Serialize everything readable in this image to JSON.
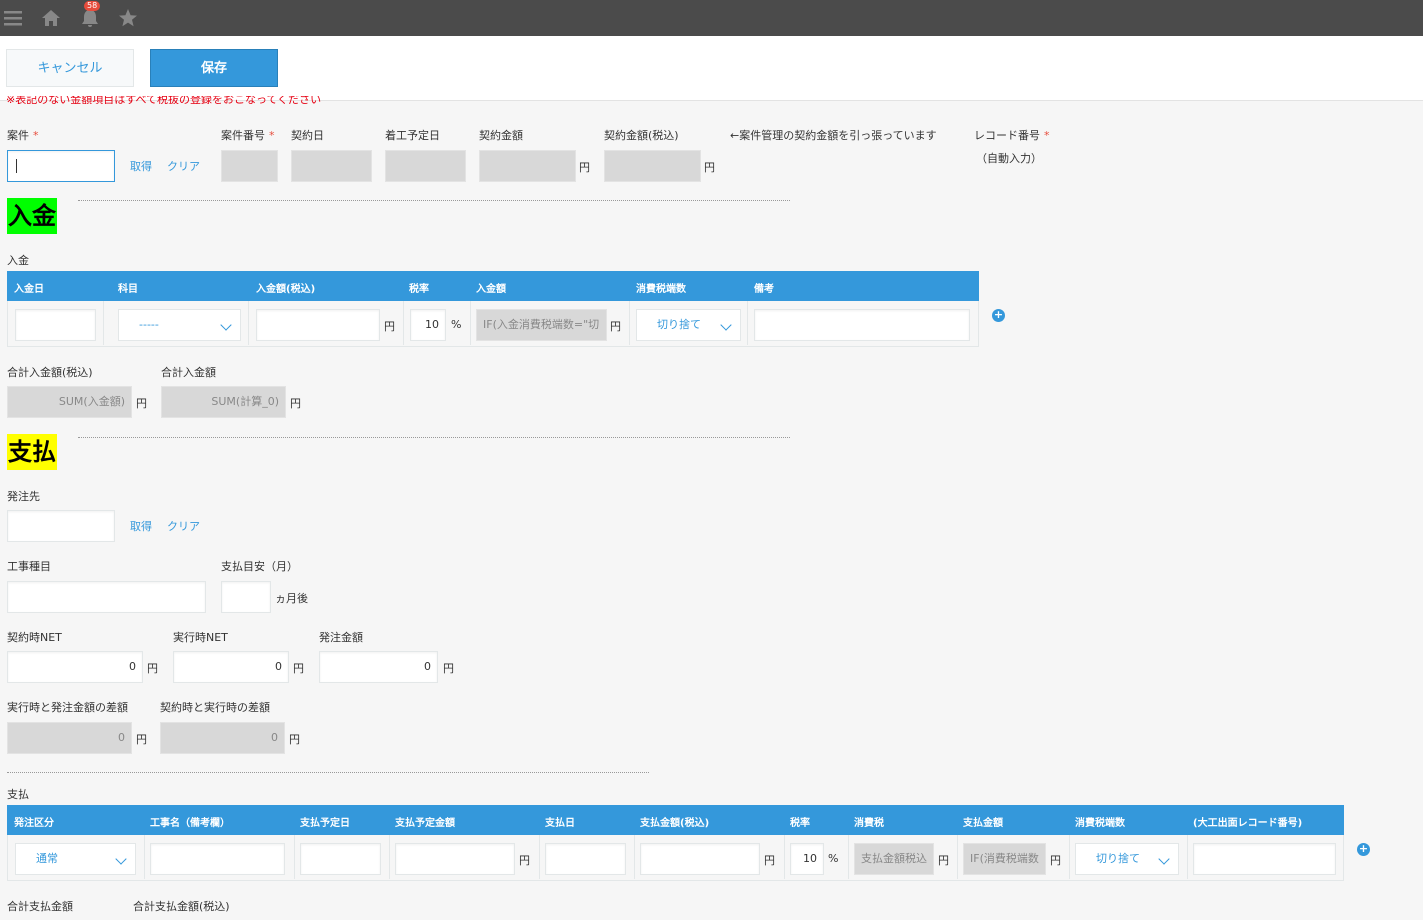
{
  "topbar": {
    "notification_count": "58"
  },
  "actions": {
    "cancel_label": "キャンセル",
    "save_label": "保存"
  },
  "notice": "※表記のない金額項目はすべて税抜の登録をおこなってください",
  "header": {
    "anken_label": "案件",
    "get_link": "取得",
    "clear_link": "クリア",
    "anken_no_label": "案件番号",
    "contract_date_label": "契約日",
    "start_date_label": "着工予定日",
    "contract_amount_label": "契約金額",
    "contract_amount_tax_label": "契約金額(税込)",
    "yen": "円",
    "note": "←案件管理の契約金額を引っ張っています",
    "record_no_label": "レコード番号",
    "record_no_value": "（自動入力）"
  },
  "nyukin": {
    "section_title": "入金",
    "table_label": "入金",
    "columns": [
      "入金日",
      "科目",
      "入金額(税込)",
      "税率",
      "入金額",
      "消費税端数",
      "備考"
    ],
    "row": {
      "subject_value": "-----",
      "yen": "円",
      "tax_rate": "10",
      "percent": "%",
      "calc_value": "IF(入金消費税端数=\"切",
      "rounding_value": "切り捨て"
    },
    "total_tax_label": "合計入金額(税込)",
    "total_tax_value": "SUM(入金額)",
    "total_label": "合計入金額",
    "total_value": "SUM(計算_0)",
    "yen": "円"
  },
  "shiharai": {
    "section_title": "支払",
    "vendor_label": "発注先",
    "get_link": "取得",
    "clear_link": "クリア",
    "work_type_label": "工事種目",
    "payment_months_label": "支払目安（月）",
    "months_unit": "ヵ月後",
    "contract_net_label": "契約時NET",
    "contract_net_value": "0",
    "exec_net_label": "実行時NET",
    "exec_net_value": "0",
    "order_amount_label": "発注金額",
    "order_amount_value": "0",
    "yen": "円",
    "diff1_label": "実行時と発注金額の差額",
    "diff1_value": "0",
    "diff2_label": "契約時と実行時の差額",
    "diff2_value": "0",
    "table_label": "支払",
    "columns": [
      "発注区分",
      "工事名（備考欄）",
      "支払予定日",
      "支払予定金額",
      "支払日",
      "支払金額(税込)",
      "税率",
      "消費税",
      "支払金額",
      "消費税端数",
      "(大工出面レコード番号)"
    ],
    "row": {
      "category_value": "通常",
      "tax_rate": "10",
      "percent": "%",
      "tax_calc": "支払金額税込",
      "amount_calc": "IF(消費税端数",
      "rounding_value": "切り捨て"
    },
    "total_label": "合計支払金額",
    "total_tax_label": "合計支払金額(税込)"
  }
}
